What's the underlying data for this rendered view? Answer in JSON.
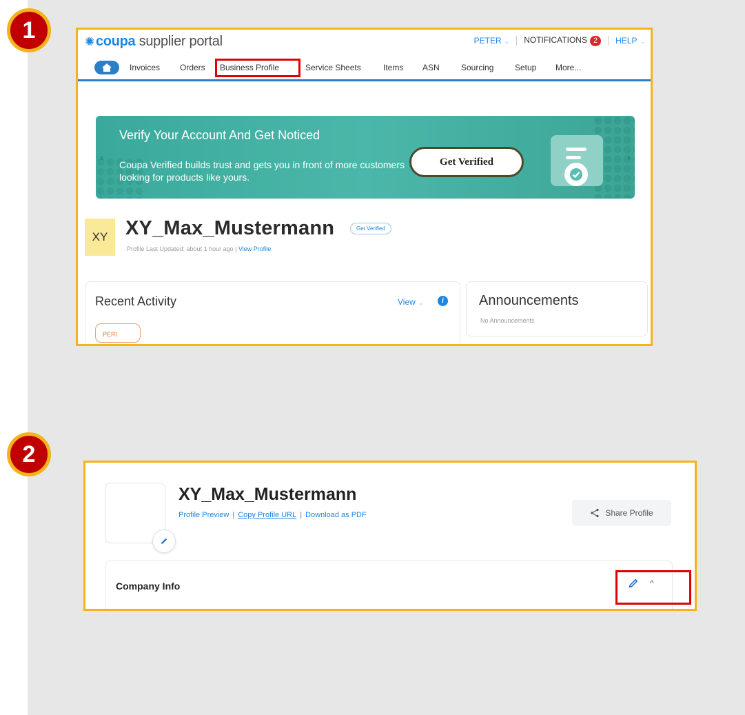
{
  "steps": [
    "1",
    "2"
  ],
  "portal": {
    "logo_brand": "coupa",
    "logo_suffix": " supplier portal",
    "user_menu": "PETER",
    "notifications_label": "NOTIFICATIONS",
    "notifications_count": "2",
    "help_label": "HELP",
    "nav": {
      "items": [
        "Invoices",
        "Orders",
        "Business Profile",
        "Service Sheets",
        "Items",
        "ASN",
        "Sourcing",
        "Setup",
        "More..."
      ],
      "highlighted": "Business Profile"
    },
    "banner": {
      "title": "Verify Your Account And Get Noticed",
      "text": "Coupa Verified builds trust and gets you in front of more customers looking for products like yours.",
      "button": "Get Verified"
    },
    "profile": {
      "initials": "XY",
      "name": "XY_Max_Mustermann",
      "pill": "Get Verified",
      "updated": "Profile Last Updated: about 1 hour ago | ",
      "view_profile": "View Profile"
    },
    "recent_activity": {
      "title": "Recent Activity",
      "view": "View",
      "tag": "PERI"
    },
    "announcements": {
      "title": "Announcements",
      "empty": "No Announcements"
    }
  },
  "profile_page": {
    "name": "XY_Max_Mustermann",
    "links": [
      "Profile Preview",
      "Copy Profile URL",
      "Download as PDF"
    ],
    "share_button": "Share Profile",
    "section_title": "Company Info"
  },
  "colors": {
    "accent": "#1c86e3",
    "badge_red": "#c00000",
    "badge_ring": "#f3b319",
    "highlight": "#e00000",
    "banner_teal": "#4bb7aa"
  }
}
